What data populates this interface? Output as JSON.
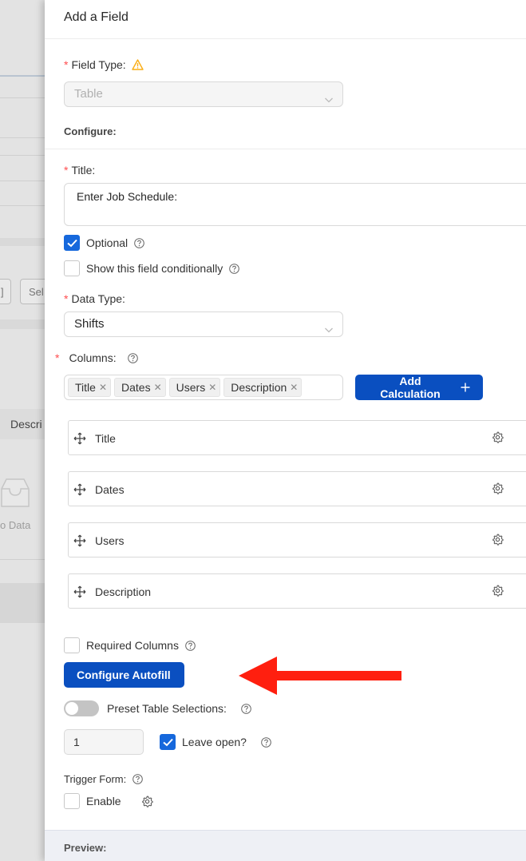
{
  "background": {
    "button_partial_1": "]",
    "button_partial_2": "Sel",
    "column_header": "Descri",
    "empty_text": "o Data"
  },
  "drawer": {
    "title": "Add a Field",
    "field_type": {
      "label": "Field Type:",
      "value": "Table",
      "warning_icon": "warning-icon"
    },
    "configure_label": "Configure:",
    "title_field": {
      "label": "Title:",
      "value": "Enter Job Schedule:"
    },
    "optional": {
      "label": "Optional",
      "checked": true
    },
    "conditional": {
      "label": "Show this field conditionally",
      "checked": false
    },
    "data_type": {
      "label": "Data Type:",
      "value": "Shifts"
    },
    "columns": {
      "label": "Columns:",
      "tags": [
        "Title",
        "Dates",
        "Users",
        "Description"
      ],
      "add_calculation": "Add Calculation",
      "rows": [
        "Title",
        "Dates",
        "Users",
        "Description"
      ]
    },
    "required_columns": {
      "label": "Required Columns",
      "checked": false
    },
    "configure_autofill": "Configure Autofill",
    "preset_table": {
      "label": "Preset Table Selections:",
      "on": false
    },
    "preset_count": "1",
    "leave_open": {
      "label": "Leave open?",
      "checked": true
    },
    "trigger_form": {
      "label": "Trigger Form:",
      "enable_label": "Enable",
      "checked": false
    },
    "preview_label": "Preview:"
  },
  "colors": {
    "primary": "#0a4fc0",
    "checkbox": "#1668dc",
    "required": "#ff4d4f",
    "warning": "#faad14",
    "arrow": "#ff1f0f"
  }
}
